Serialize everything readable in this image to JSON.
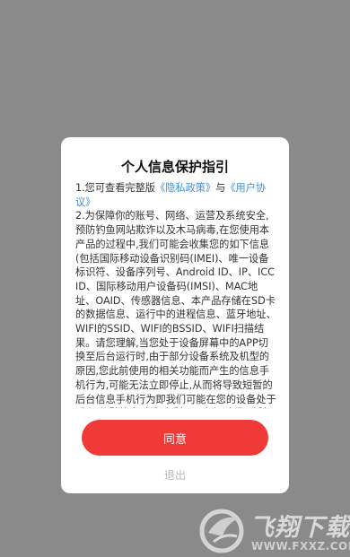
{
  "dialog": {
    "title": "个人信息保护指引",
    "para1_prefix": "1.您可查看完整版",
    "privacy_link": "《隐私政策》",
    "para1_mid": "与",
    "user_link": "《用户协议》",
    "para2": "2.为保障你的账号、网络、运营及系统安全,预防钓鱼网站欺诈以及木马病毒,在您使用本产品的过程中,我们可能会收集您的如下信息(包括国际移动设备识别码(IMEI)、唯一设备标识符、设备序列号、Android ID、IP、ICCID、国际移动用户设备码(IMSI)、MAC地址、OAID、传感器信息、本产品存储在SD卡的数据信息、运行中的进程信息、蓝牙地址、WIFI的SSID、WIFI的BSSID、WIFI扫描结果。请您理解,当您处于设备屏幕中的APP切换至后台运行时,由于部分设备系统及机型的原因,您此前使用的相关功能而产生的信息手机行为,可能无法立即停止,从而将导致短暂的后台信息手机行为即我们可能在您的设备处于后台/静默状态时候时手机,只有经过明示授权才会在实现功能或",
    "agree_label": "同意",
    "exit_label": "退出"
  },
  "watermark": {
    "brand": "飞翔下载",
    "url": "WWW.FXXZ.COM"
  },
  "colors": {
    "accent": "#f03a37",
    "link": "#3d8fdc",
    "overlay": "#8a8a8a"
  }
}
